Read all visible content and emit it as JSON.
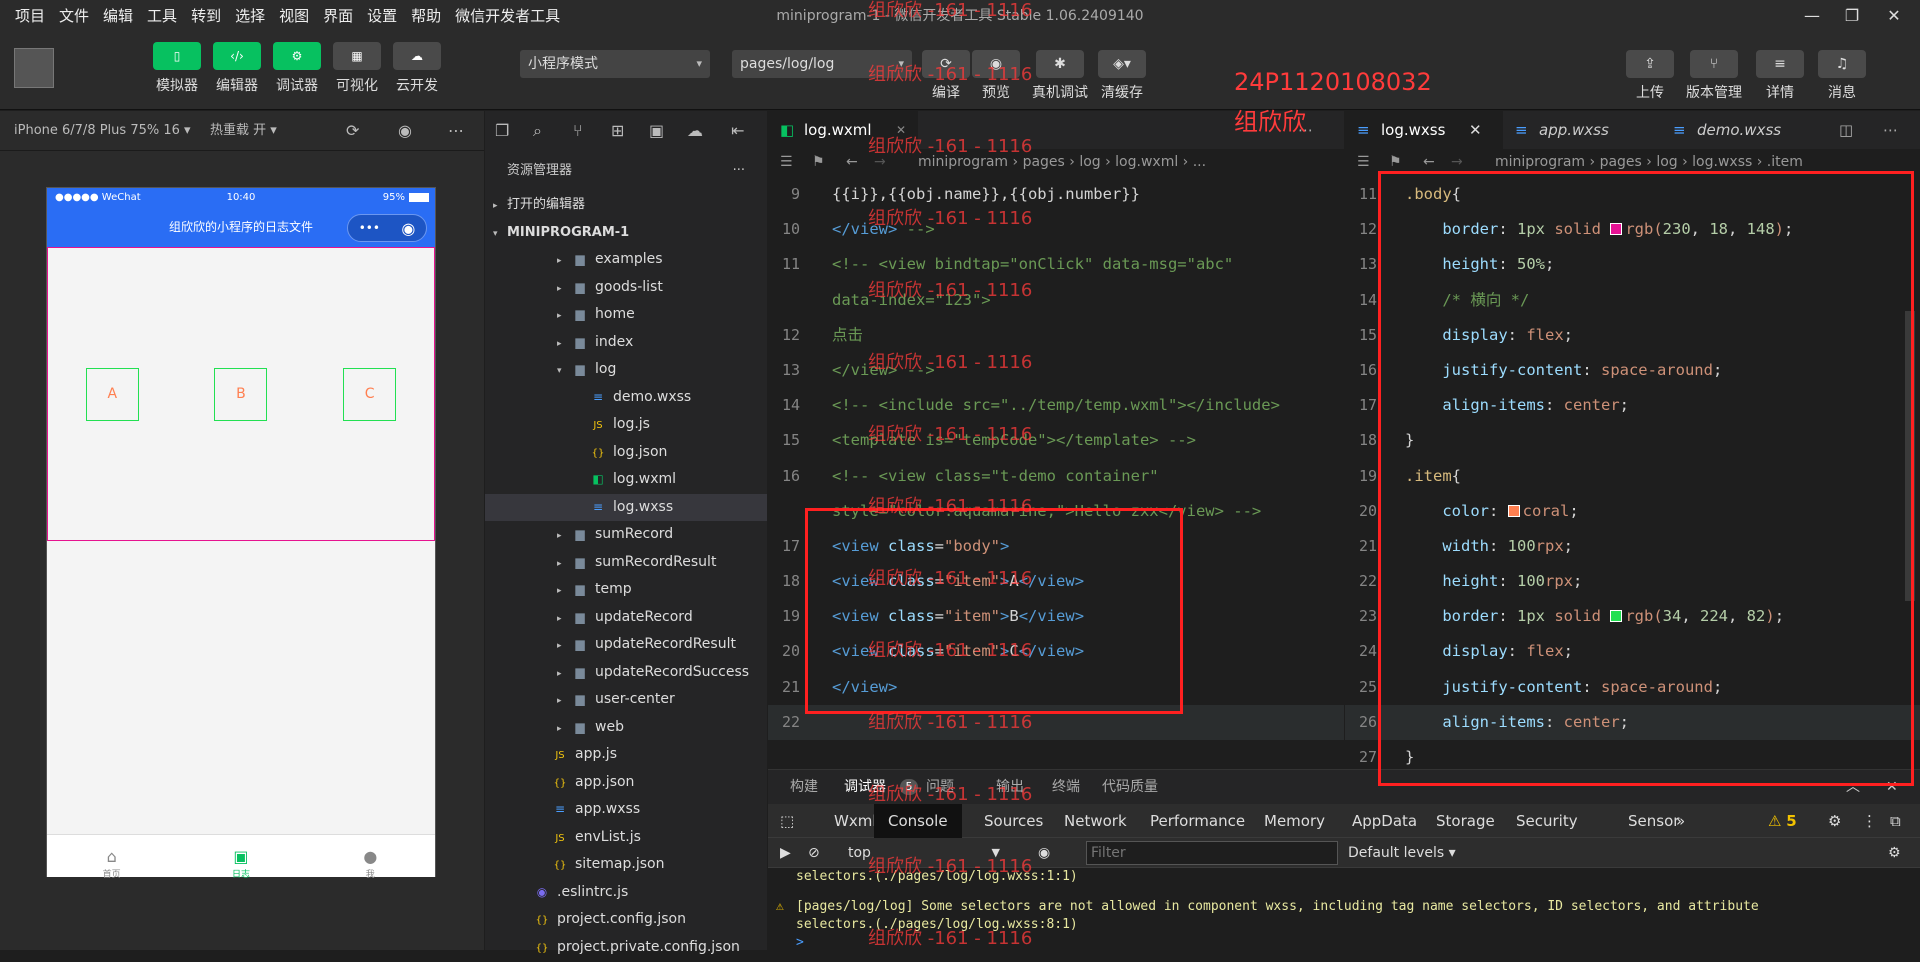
{
  "menu": [
    "项目",
    "文件",
    "编辑",
    "工具",
    "转到",
    "选择",
    "视图",
    "界面",
    "设置",
    "帮助",
    "微信开发者工具"
  ],
  "window_title": "miniprogram-1 - 微信开发者工具 Stable 1.06.2409140",
  "toolbar": {
    "left": [
      {
        "label": "模拟器",
        "icon": "phone-icon"
      },
      {
        "label": "编辑器",
        "icon": "code-icon"
      },
      {
        "label": "调试器",
        "icon": "debug-icon"
      },
      {
        "label": "可视化",
        "icon": "layout-icon"
      },
      {
        "label": "云开发",
        "icon": "cloud-icon"
      }
    ],
    "mode": "小程序模式",
    "page": "pages/log/log",
    "mid": [
      {
        "label": "编译",
        "icon": "refresh-icon"
      },
      {
        "label": "预览",
        "icon": "eye-icon"
      },
      {
        "label": "真机调试",
        "icon": "bug-icon"
      },
      {
        "label": "清缓存",
        "icon": "layers-icon"
      }
    ],
    "right": [
      {
        "label": "上传",
        "icon": "upload-icon"
      },
      {
        "label": "版本管理",
        "icon": "branch-icon"
      },
      {
        "label": "详情",
        "icon": "menu-icon"
      },
      {
        "label": "消息",
        "icon": "bell-icon"
      }
    ]
  },
  "simulator": {
    "device": "iPhone 6/7/8 Plus 75% 16 ▾",
    "hot_reload": "热重载 开 ▾",
    "status_left": "●●●●● WeChat",
    "status_time": "10:40",
    "status_right": "95%",
    "nav_title": "组欣欣的小程序的日志文件",
    "capsule_dots": "•••",
    "items": [
      "A",
      "B",
      "C"
    ],
    "tabbar": [
      {
        "label": "首页",
        "icon": "home-icon"
      },
      {
        "label": "日志",
        "icon": "terminal-icon"
      },
      {
        "label": "我",
        "icon": "user-icon"
      }
    ]
  },
  "explorer": {
    "title": "资源管理器",
    "more": "···",
    "open_editors": "打开的编辑器",
    "project": "MINIPROGRAM-1",
    "tree": [
      {
        "name": "examples",
        "depth": 2,
        "type": "folder",
        "arrow": "▸"
      },
      {
        "name": "goods-list",
        "depth": 2,
        "type": "folder",
        "arrow": "▸"
      },
      {
        "name": "home",
        "depth": 2,
        "type": "folder",
        "arrow": "▸"
      },
      {
        "name": "index",
        "depth": 2,
        "type": "folder",
        "arrow": "▸"
      },
      {
        "name": "log",
        "depth": 2,
        "type": "folder",
        "arrow": "▾"
      },
      {
        "name": "demo.wxss",
        "depth": 3,
        "type": "wxss",
        "arrow": ""
      },
      {
        "name": "log.js",
        "depth": 3,
        "type": "js",
        "arrow": ""
      },
      {
        "name": "log.json",
        "depth": 3,
        "type": "json",
        "arrow": ""
      },
      {
        "name": "log.wxml",
        "depth": 3,
        "type": "wxml",
        "arrow": ""
      },
      {
        "name": "log.wxss",
        "depth": 3,
        "type": "wxss",
        "arrow": "",
        "selected": true
      },
      {
        "name": "sumRecord",
        "depth": 2,
        "type": "folder",
        "arrow": "▸"
      },
      {
        "name": "sumRecordResult",
        "depth": 2,
        "type": "folder",
        "arrow": "▸"
      },
      {
        "name": "temp",
        "depth": 2,
        "type": "folder",
        "arrow": "▸"
      },
      {
        "name": "updateRecord",
        "depth": 2,
        "type": "folder",
        "arrow": "▸"
      },
      {
        "name": "updateRecordResult",
        "depth": 2,
        "type": "folder",
        "arrow": "▸"
      },
      {
        "name": "updateRecordSuccess",
        "depth": 2,
        "type": "folder",
        "arrow": "▸"
      },
      {
        "name": "user-center",
        "depth": 2,
        "type": "folder",
        "arrow": "▸"
      },
      {
        "name": "web",
        "depth": 2,
        "type": "folder",
        "arrow": "▸"
      },
      {
        "name": "app.js",
        "depth": 1,
        "type": "js",
        "arrow": ""
      },
      {
        "name": "app.json",
        "depth": 1,
        "type": "json",
        "arrow": ""
      },
      {
        "name": "app.wxss",
        "depth": 1,
        "type": "wxss",
        "arrow": ""
      },
      {
        "name": "envList.js",
        "depth": 1,
        "type": "js",
        "arrow": ""
      },
      {
        "name": "sitemap.json",
        "depth": 1,
        "type": "json",
        "arrow": ""
      },
      {
        "name": ".eslintrc.js",
        "depth": 0,
        "type": "eslint",
        "arrow": ""
      },
      {
        "name": "project.config.json",
        "depth": 0,
        "type": "json",
        "arrow": ""
      },
      {
        "name": "project.private.config.json",
        "depth": 0,
        "type": "json",
        "arrow": ""
      }
    ]
  },
  "editor1": {
    "tab": "log.wxml",
    "close": "✕",
    "crumb": [
      "miniprogram",
      "pages",
      "log",
      "log.wxml",
      "..."
    ],
    "lines": [
      {
        "n": "9",
        "code": [
          [
            "pl",
            "{{i}},{{obj.name}},{{obj.number}}"
          ]
        ]
      },
      {
        "n": "10",
        "code": [
          [
            "tg",
            "</view>"
          ],
          [
            "cm",
            " -->"
          ]
        ]
      },
      {
        "n": "11",
        "code": [
          [
            "cm",
            "<!-- <view bindtap=\"onClick\" data-msg=\"abc\""
          ]
        ]
      },
      {
        "n": "",
        "code": [
          [
            "cm",
            "data-index=\"123\">"
          ]
        ]
      },
      {
        "n": "12",
        "code": [
          [
            "cm",
            "点击"
          ]
        ]
      },
      {
        "n": "13",
        "code": [
          [
            "cm",
            "</view> -->"
          ]
        ]
      },
      {
        "n": "14",
        "code": [
          [
            "cm",
            "<!-- <include src=\"../temp/temp.wxml\"></include>"
          ]
        ]
      },
      {
        "n": "15",
        "code": [
          [
            "cm",
            "<template is=\"tempCode\"></template> -->"
          ]
        ]
      },
      {
        "n": "16",
        "code": [
          [
            "cm",
            "<!-- <view class=\"t-demo container\""
          ]
        ]
      },
      {
        "n": "",
        "code": [
          [
            "cm",
            "style=\"color:aquamarine;\">Hello zxx</view> -->"
          ]
        ]
      },
      {
        "n": "17",
        "code": [
          [
            "tg",
            "<view "
          ],
          [
            "at",
            "class"
          ],
          [
            "pl",
            "="
          ],
          [
            "st",
            "\"body\""
          ],
          [
            "tg",
            ">"
          ]
        ]
      },
      {
        "n": "18",
        "code": [
          [
            "tg",
            "<view "
          ],
          [
            "at",
            "class"
          ],
          [
            "pl",
            "="
          ],
          [
            "st",
            "\"item\""
          ],
          [
            "tg",
            ">"
          ],
          [
            "pl",
            "A"
          ],
          [
            "tg",
            "</view>"
          ]
        ]
      },
      {
        "n": "19",
        "code": [
          [
            "tg",
            "<view "
          ],
          [
            "at",
            "class"
          ],
          [
            "pl",
            "="
          ],
          [
            "st",
            "\"item\""
          ],
          [
            "tg",
            ">"
          ],
          [
            "pl",
            "B"
          ],
          [
            "tg",
            "</view>"
          ]
        ]
      },
      {
        "n": "20",
        "code": [
          [
            "tg",
            "<view "
          ],
          [
            "at",
            "class"
          ],
          [
            "pl",
            "="
          ],
          [
            "st",
            "\"item\""
          ],
          [
            "tg",
            ">"
          ],
          [
            "pl",
            "C"
          ],
          [
            "tg",
            "</view>"
          ]
        ]
      },
      {
        "n": "21",
        "code": [
          [
            "tg",
            "</view>"
          ]
        ]
      },
      {
        "n": "22",
        "code": [],
        "current": true
      }
    ]
  },
  "editor2": {
    "tabs": [
      "log.wxss",
      "app.wxss",
      "demo.wxss"
    ],
    "crumb": [
      "miniprogram",
      "pages",
      "log",
      "log.wxss",
      ".item"
    ],
    "lines": [
      {
        "n": "11",
        "code": [
          [
            "sl",
            ".body"
          ],
          [
            "pl",
            "{"
          ]
        ]
      },
      {
        "n": "12",
        "code": [
          [
            "pr",
            "    border"
          ],
          [
            "pl",
            ": "
          ],
          [
            "nm",
            "1px "
          ],
          [
            "vl",
            "solid "
          ],
          [
            "sw",
            "#e61294"
          ],
          [
            "vl",
            "rgb("
          ],
          [
            "nm",
            "230"
          ],
          [
            "pl",
            ", "
          ],
          [
            "nm",
            "18"
          ],
          [
            "pl",
            ", "
          ],
          [
            "nm",
            "148"
          ],
          [
            "vl",
            ")"
          ],
          [
            "pl",
            ";"
          ]
        ]
      },
      {
        "n": "13",
        "code": [
          [
            "pr",
            "    height"
          ],
          [
            "pl",
            ": "
          ],
          [
            "nm",
            "50%"
          ],
          [
            "pl",
            ";"
          ]
        ]
      },
      {
        "n": "14",
        "code": [
          [
            "cm",
            "    /* 横向 */"
          ]
        ]
      },
      {
        "n": "15",
        "code": [
          [
            "pr",
            "    display"
          ],
          [
            "pl",
            ": "
          ],
          [
            "vl",
            "flex"
          ],
          [
            "pl",
            ";"
          ]
        ]
      },
      {
        "n": "16",
        "code": [
          [
            "pr",
            "    justify-content"
          ],
          [
            "pl",
            ": "
          ],
          [
            "vl",
            "space-around"
          ],
          [
            "pl",
            ";"
          ]
        ]
      },
      {
        "n": "17",
        "code": [
          [
            "pr",
            "    align-items"
          ],
          [
            "pl",
            ": "
          ],
          [
            "vl",
            "center"
          ],
          [
            "pl",
            ";"
          ]
        ]
      },
      {
        "n": "18",
        "code": [
          [
            "pl",
            "}"
          ]
        ]
      },
      {
        "n": "19",
        "code": [
          [
            "sl",
            ".item"
          ],
          [
            "pl",
            "{"
          ]
        ]
      },
      {
        "n": "20",
        "code": [
          [
            "pr",
            "    color"
          ],
          [
            "pl",
            ": "
          ],
          [
            "sw",
            "#ff7f50"
          ],
          [
            "vl",
            "coral"
          ],
          [
            "pl",
            ";"
          ]
        ]
      },
      {
        "n": "21",
        "code": [
          [
            "pr",
            "    width"
          ],
          [
            "pl",
            ": "
          ],
          [
            "nm",
            "100"
          ],
          [
            "vl",
            "rpx"
          ],
          [
            "pl",
            ";"
          ]
        ]
      },
      {
        "n": "22",
        "code": [
          [
            "pr",
            "    height"
          ],
          [
            "pl",
            ": "
          ],
          [
            "nm",
            "100"
          ],
          [
            "vl",
            "rpx"
          ],
          [
            "pl",
            ";"
          ]
        ]
      },
      {
        "n": "23",
        "code": [
          [
            "pr",
            "    border"
          ],
          [
            "pl",
            ": "
          ],
          [
            "nm",
            "1px "
          ],
          [
            "vl",
            "solid "
          ],
          [
            "sw",
            "#22e052"
          ],
          [
            "vl",
            "rgb("
          ],
          [
            "nm",
            "34"
          ],
          [
            "pl",
            ", "
          ],
          [
            "nm",
            "224"
          ],
          [
            "pl",
            ", "
          ],
          [
            "nm",
            "82"
          ],
          [
            "vl",
            ")"
          ],
          [
            "pl",
            ";"
          ]
        ]
      },
      {
        "n": "24",
        "code": [
          [
            "pr",
            "    display"
          ],
          [
            "pl",
            ": "
          ],
          [
            "vl",
            "flex"
          ],
          [
            "pl",
            ";"
          ]
        ]
      },
      {
        "n": "25",
        "code": [
          [
            "pr",
            "    justify-content"
          ],
          [
            "pl",
            ": "
          ],
          [
            "vl",
            "space-around"
          ],
          [
            "pl",
            ";"
          ]
        ]
      },
      {
        "n": "26",
        "code": [
          [
            "pr",
            "    align-items"
          ],
          [
            "pl",
            ": "
          ],
          [
            "vl",
            "center"
          ],
          [
            "pl",
            ";"
          ]
        ],
        "current": true
      },
      {
        "n": "27",
        "code": [
          [
            "pl",
            "}"
          ]
        ]
      }
    ]
  },
  "bottom": {
    "tabs": [
      "构建",
      "调试器",
      "问题",
      "输出",
      "终端",
      "代码质量"
    ],
    "badge": "5",
    "devtools": [
      "Wxml",
      "Console",
      "Sources",
      "Network",
      "Performance",
      "Memory",
      "AppData",
      "Storage",
      "Security",
      "Sensor",
      "»"
    ],
    "warn_count": "5",
    "context": "top",
    "filter_placeholder": "Filter",
    "levels": "Default levels ▾",
    "console": [
      {
        "text": "selectors.(./pages/log/log.wxss:1:1)",
        "warn": false
      },
      {
        "text": "[pages/log/log] Some selectors are not allowed in component wxss, including tag name selectors, ID selectors, and attribute",
        "warn": true
      },
      {
        "text": "selectors.(./pages/log/log.wxss:8:1)",
        "warn": false
      },
      {
        "text": ">",
        "warn": false
      }
    ]
  },
  "watermark": {
    "id": "24P1120108032",
    "name": "组欣欣",
    "tag": "组欣欣 -161 - 1116"
  },
  "colors": {
    "accent": "#07c160",
    "wechat_blue": "#2a6df4",
    "red_box": "#ff2020"
  }
}
